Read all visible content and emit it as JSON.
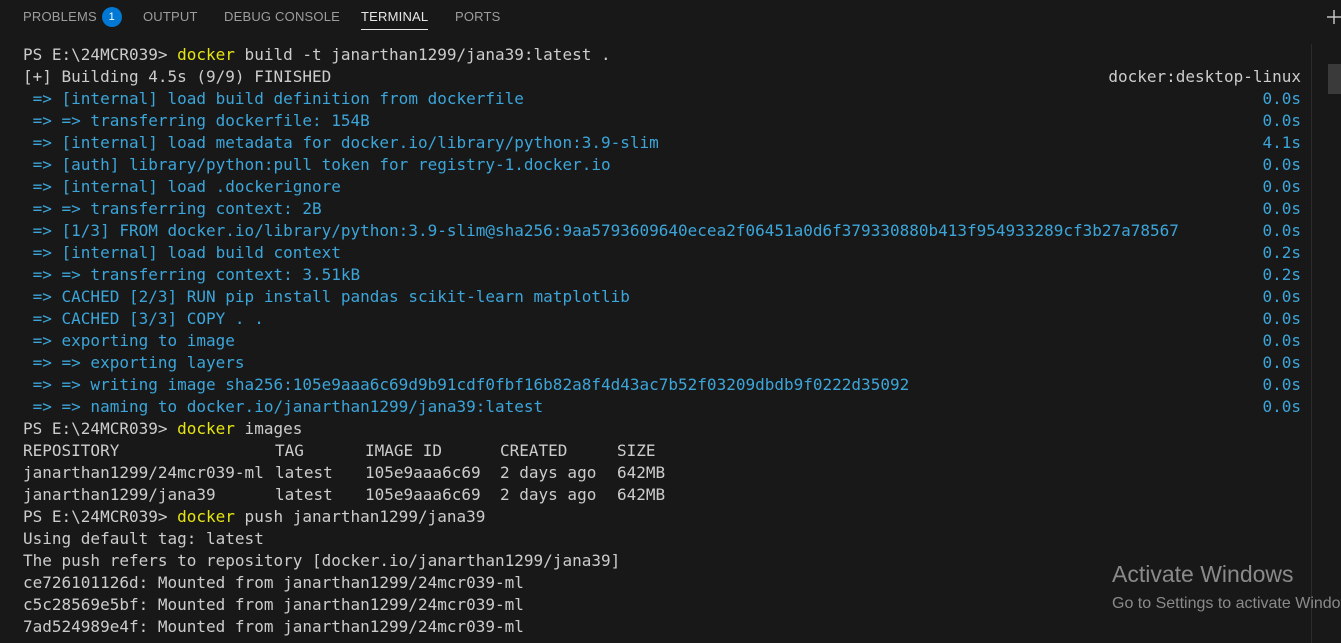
{
  "tabs": [
    {
      "label": "PROBLEMS",
      "badge": "1"
    },
    {
      "label": "OUTPUT"
    },
    {
      "label": "DEBUG CONSOLE"
    },
    {
      "label": "TERMINAL",
      "active": true
    },
    {
      "label": "PORTS"
    }
  ],
  "toolbar": {
    "new_terminal_icon": "plus-icon"
  },
  "terminal": {
    "build": {
      "prompt": "PS E:\\24MCR039> ",
      "cmd": "docker",
      "args": " build -t janarthan1299/jana39:latest ."
    },
    "status": {
      "text": "[+] Building 4.5s (9/9) FINISHED",
      "context": "docker:desktop-linux"
    },
    "steps": [
      {
        "text": " => [internal] load build definition from dockerfile",
        "time": "0.0s"
      },
      {
        "text": " => => transferring dockerfile: 154B",
        "time": "0.0s"
      },
      {
        "text": " => [internal] load metadata for docker.io/library/python:3.9-slim",
        "time": "4.1s"
      },
      {
        "text": " => [auth] library/python:pull token for registry-1.docker.io",
        "time": "0.0s"
      },
      {
        "text": " => [internal] load .dockerignore",
        "time": "0.0s"
      },
      {
        "text": " => => transferring context: 2B",
        "time": "0.0s"
      },
      {
        "text": " => [1/3] FROM docker.io/library/python:3.9-slim@sha256:9aa5793609640ecea2f06451a0d6f379330880b413f954933289cf3b27a78567",
        "time": "0.0s"
      },
      {
        "text": " => [internal] load build context",
        "time": "0.2s"
      },
      {
        "text": " => => transferring context: 3.51kB",
        "time": "0.2s"
      },
      {
        "text": " => CACHED [2/3] RUN pip install pandas scikit-learn matplotlib",
        "time": "0.0s"
      },
      {
        "text": " => CACHED [3/3] COPY . .",
        "time": "0.0s"
      },
      {
        "text": " => exporting to image",
        "time": "0.0s"
      },
      {
        "text": " => => exporting layers",
        "time": "0.0s"
      },
      {
        "text": " => => writing image sha256:105e9aaa6c69d9b91cdf0fbf16b82a8f4d43ac7b52f03209dbdb9f0222d35092",
        "time": "0.0s"
      },
      {
        "text": " => => naming to docker.io/janarthan1299/jana39:latest",
        "time": "0.0s"
      }
    ],
    "images_cmd": {
      "prompt": "PS E:\\24MCR039> ",
      "cmd": "docker",
      "args": " images"
    },
    "images_header": {
      "repository": "REPOSITORY",
      "tag": "TAG",
      "image_id": "IMAGE ID",
      "created": "CREATED",
      "size": "SIZE"
    },
    "images": [
      {
        "repository": "janarthan1299/24mcr039-ml",
        "tag": "latest",
        "image_id": "105e9aaa6c69",
        "created": "2 days ago",
        "size": "642MB"
      },
      {
        "repository": "janarthan1299/jana39",
        "tag": "latest",
        "image_id": "105e9aaa6c69",
        "created": "2 days ago",
        "size": "642MB"
      }
    ],
    "push_cmd": {
      "prompt": "PS E:\\24MCR039> ",
      "cmd": "docker",
      "args": " push janarthan1299/jana39"
    },
    "push_output": [
      "Using default tag: latest",
      "The push refers to repository [docker.io/janarthan1299/jana39]",
      "ce726101126d: Mounted from janarthan1299/24mcr039-ml",
      "c5c28569e5bf: Mounted from janarthan1299/24mcr039-ml",
      "7ad524989e4f: Mounted from janarthan1299/24mcr039-ml"
    ]
  },
  "watermark": {
    "title": "Activate Windows",
    "subtitle": "Go to Settings to activate Windows."
  },
  "colors": {
    "background": "#181818",
    "text": "#cccccc",
    "info": "#3ca5d9",
    "command": "#e5e510",
    "badge": "#0078d4"
  }
}
